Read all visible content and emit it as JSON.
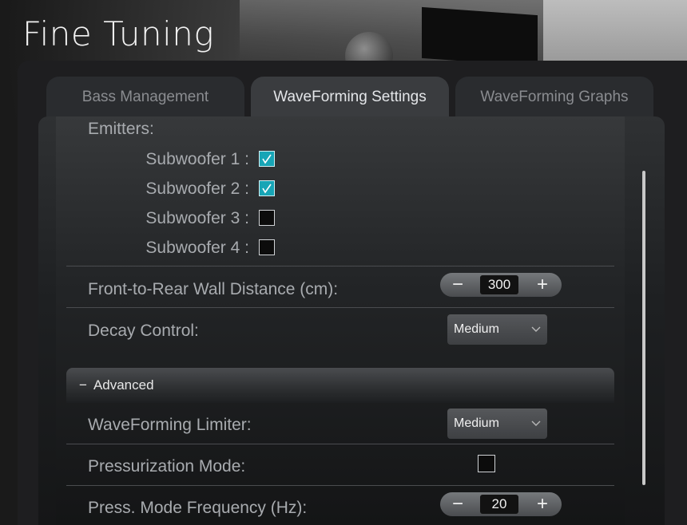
{
  "page_title": "Fine Tuning",
  "tabs": [
    {
      "label": "Bass Management",
      "active": false
    },
    {
      "label": "WaveForming Settings",
      "active": true
    },
    {
      "label": "WaveForming Graphs",
      "active": false
    }
  ],
  "emitters": {
    "label": "Emitters:",
    "items": [
      {
        "label": "Subwoofer 1 :",
        "checked": true
      },
      {
        "label": "Subwoofer 2 :",
        "checked": true
      },
      {
        "label": "Subwoofer 3 :",
        "checked": false
      },
      {
        "label": "Subwoofer 4 :",
        "checked": false
      }
    ]
  },
  "front_rear": {
    "label": "Front-to-Rear Wall Distance (cm):",
    "value": "300",
    "minus": "−",
    "plus": "+"
  },
  "decay": {
    "label": "Decay Control:",
    "value": "Medium"
  },
  "advanced": {
    "label": "Advanced",
    "toggle": "−"
  },
  "limiter": {
    "label": "WaveForming Limiter:",
    "value": "Medium"
  },
  "pressurization": {
    "label": "Pressurization Mode:",
    "checked": false
  },
  "press_freq": {
    "label": "Press. Mode Frequency (Hz):",
    "value": "20",
    "minus": "−",
    "plus": "+"
  },
  "colors": {
    "accent": "#17a5b6"
  }
}
